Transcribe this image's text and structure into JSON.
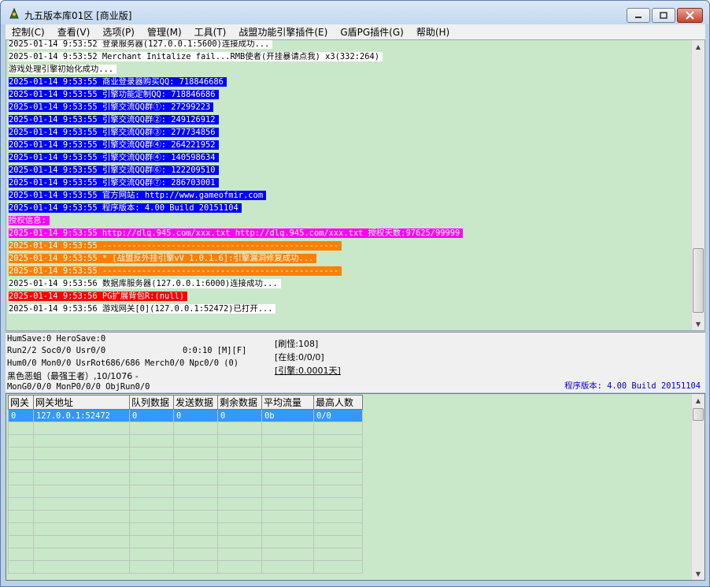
{
  "window": {
    "title": "九五版本库01区 [商业版]"
  },
  "menu": [
    "控制(C)",
    "查看(V)",
    "选项(P)",
    "管理(M)",
    "工具(T)",
    "战盟功能引擎插件(E)",
    "G盾PG插件(G)",
    "帮助(H)"
  ],
  "log": [
    {
      "text": "2025-01-14 9:53:52 登录服务器(127.0.0.1:5600)连接成功...",
      "style": "plain"
    },
    {
      "text": "2025-01-14 9:53:52 Merchant Initalize fail...RMB使者(开挂暴请点我) x3(332:264)",
      "style": "plain"
    },
    {
      "text": "游戏处理引擎初始化成功...",
      "style": "plain"
    },
    {
      "text": "2025-01-14 9:53:55 商业登录器购买QQ: 718846686",
      "style": "blue"
    },
    {
      "text": "2025-01-14 9:53:55 引擎功能定制QQ: 718846686",
      "style": "blue"
    },
    {
      "text": "2025-01-14 9:53:55 引擎交流QQ群①: 27299223",
      "style": "blue"
    },
    {
      "text": "2025-01-14 9:53:55 引擎交流QQ群②: 249126912",
      "style": "blue"
    },
    {
      "text": "2025-01-14 9:53:55 引擎交流QQ群③: 277734856",
      "style": "blue"
    },
    {
      "text": "2025-01-14 9:53:55 引擎交流QQ群④: 264221952",
      "style": "blue"
    },
    {
      "text": "2025-01-14 9:53:55 引擎交流QQ群④: 140598634",
      "style": "blue"
    },
    {
      "text": "2025-01-14 9:53:55 引擎交流QQ群⑥: 122209510",
      "style": "blue"
    },
    {
      "text": "2025-01-14 9:53:55 引擎交流QQ群⑦: 286703001",
      "style": "blue"
    },
    {
      "text": "2025-01-14 9:53:55 官方网站: http://www.gameofmir.com",
      "style": "blue"
    },
    {
      "text": "2025-01-14 9:53:55 程序版本: 4.00 Build 20151104",
      "style": "blue"
    },
    {
      "text": "授权信息:",
      "style": "magenta"
    },
    {
      "text": "2025-01-14 9:53:55 http://dlq.945.com/xxx.txt http://dlq.945.com/xxx.txt 授权天数:97625/99999",
      "style": "magenta"
    },
    {
      "text": "2025-01-14 9:53:55 ------------------------------------------------",
      "style": "orange"
    },
    {
      "text": "2025-01-14 9:53:55 * [战盟反外挂引擎vV 1.0.1.6]:引擎漏洞修复成功...",
      "style": "orange"
    },
    {
      "text": "2025-01-14 9:53:55 ------------------------------------------------",
      "style": "orange"
    },
    {
      "text": "2025-01-14 9:53:56 数据库服务器(127.0.0.1:6000)连接成功...",
      "style": "plain"
    },
    {
      "text": "2025-01-14 9:53:56 PG扩展背包R:(null)",
      "style": "red"
    },
    {
      "text": "2025-01-14 9:53:56 游戏网关[0](127.0.0.1:52472)已打开...",
      "style": "plain"
    }
  ],
  "status": {
    "line1": "HumSave:0 HeroSave:0",
    "line2": "Run2/2 Soc0/0 Usr0/0",
    "timer": "0:0:10 [M][F]",
    "line3": "Hum0/0 Mon0/0 UsrRot686/686 Merch0/0 Npc0/0 (0)",
    "line4": "黑色恶蛆（最强王者）,10/1076 -",
    "line5": "MonG0/0/0 MonP0/0/0 ObjRun0/0",
    "refresh": "[刷怪:108]",
    "online": "[在线:0/0/0]",
    "engine": "[引擎:0.0001天]",
    "version": "程序版本: 4.00 Build 20151104"
  },
  "grid": {
    "headers": [
      "网关",
      "网关地址",
      "队列数据",
      "发送数据",
      "剩余数据",
      "平均流量",
      "最高人数"
    ],
    "rows": [
      [
        "0",
        "127.0.0.1:52472",
        "0",
        "0",
        "0",
        "0b",
        "0/0"
      ]
    ],
    "empty_rows": 12
  },
  "colors": {
    "log_bg": "#c9e8c9",
    "blue": "#0000ff",
    "magenta": "#ff00ff",
    "orange": "#ff7f00",
    "red": "#ff0000",
    "selection": "#3399ff"
  }
}
